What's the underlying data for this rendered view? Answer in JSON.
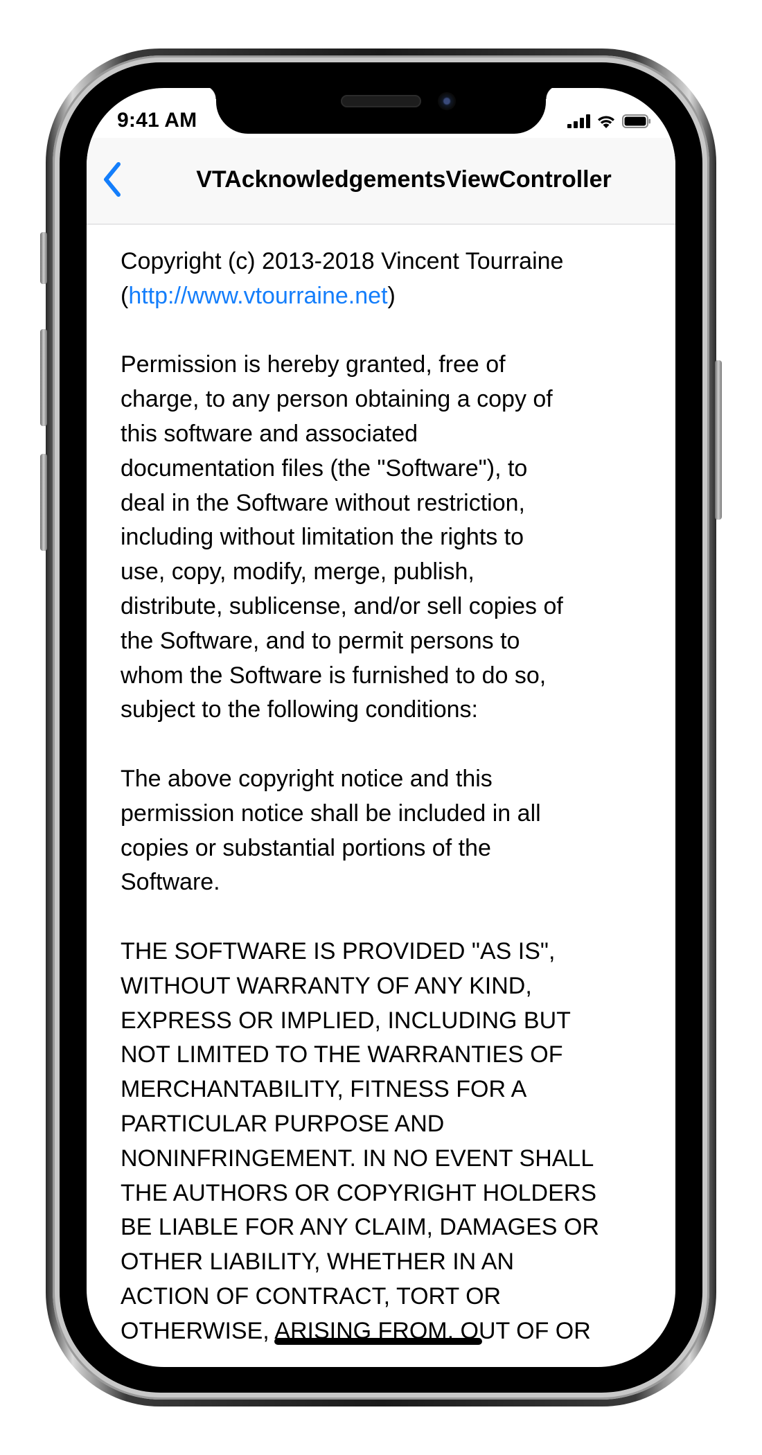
{
  "status_bar": {
    "time": "9:41 AM",
    "icons": [
      "signal-icon",
      "wifi-icon",
      "battery-icon"
    ]
  },
  "nav": {
    "back_icon": "chevron-left-icon",
    "title": "VTAcknowledgementsViewController"
  },
  "license": {
    "copyright_prefix": "Copyright (c) 2013-2018 Vincent Tourraine\n(",
    "copyright_link": "http://www.vtourraine.net",
    "copyright_suffix": ")",
    "permission": "Permission is hereby granted, free of\ncharge, to any person obtaining a copy of\nthis software and associated\ndocumentation files (the \"Software\"), to\ndeal in the Software without restriction,\nincluding without limitation the rights to\nuse, copy, modify, merge, publish,\ndistribute, sublicense, and/or sell copies of\nthe Software, and to permit persons to\nwhom the Software is furnished to do so,\nsubject to the following conditions:",
    "notice": "The above copyright notice and this\npermission notice shall be included in all\ncopies or substantial portions of the\nSoftware.",
    "disclaimer": "THE SOFTWARE IS PROVIDED \"AS IS\",\nWITHOUT WARRANTY OF ANY KIND,\nEXPRESS OR IMPLIED, INCLUDING BUT\nNOT LIMITED TO THE WARRANTIES OF\nMERCHANTABILITY, FITNESS FOR A\nPARTICULAR PURPOSE AND\nNONINFRINGEMENT. IN NO EVENT SHALL\nTHE AUTHORS OR COPYRIGHT HOLDERS\nBE LIABLE FOR ANY CLAIM, DAMAGES OR\nOTHER LIABILITY, WHETHER IN AN\nACTION OF CONTRACT, TORT OR\nOTHERWISE, ARISING FROM, OUT OF OR"
  },
  "colors": {
    "accent": "#147efb",
    "nav_background": "#f8f8f8",
    "text": "#000000"
  }
}
